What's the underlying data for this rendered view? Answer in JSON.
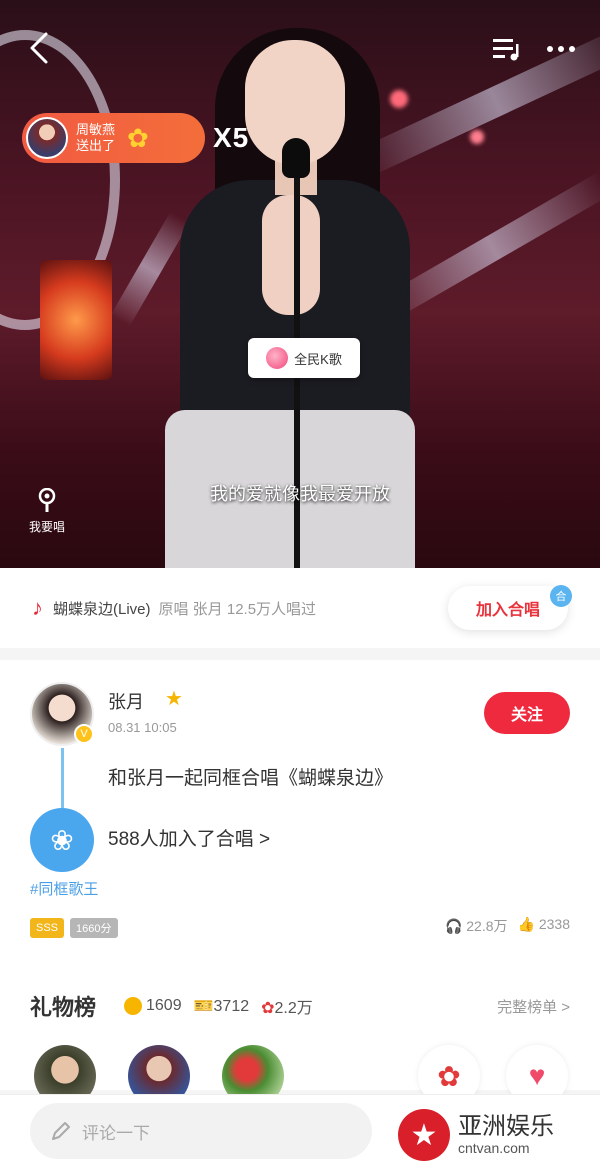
{
  "video": {
    "gift_sender_name": "周敏燕",
    "gift_sender_action": "送出了",
    "gift_count": "X5",
    "logo_text": "全民K歌",
    "solo_label": "我要唱",
    "lyric": "我的爱就像我最爱开放"
  },
  "song": {
    "title": "蝴蝶泉边(Live)",
    "meta": "原唱 张月 12.5万人唱过",
    "join_label": "加入合唱",
    "join_badge": "合"
  },
  "post": {
    "username": "张月",
    "time": "08.31 10:05",
    "follow_label": "关注",
    "text": "和张月一起同框合唱《蝴蝶泉边》",
    "joined": "588人加入了合唱 >",
    "hashtag": "#同框歌王",
    "tag1": "SSS",
    "tag2": "1660分",
    "plays": "22.8万",
    "likes": "2338",
    "verified": "V"
  },
  "gifts": {
    "title": "礼物榜",
    "coins": "1609",
    "tickets": "3712",
    "flowers": "2.2万",
    "full_rank": "完整榜单 >"
  },
  "bottom": {
    "comment_placeholder": "评论一下"
  },
  "watermark": {
    "cn": "亚洲娱乐",
    "en": "cntvan.com"
  },
  "icons": {
    "back": "back-arrow-icon",
    "playlist": "playlist-icon",
    "more": "more-icon",
    "music": "music-note-icon",
    "chorus": "chorus-icon"
  },
  "colors": {
    "accent_red": "#ef2a3e",
    "link_blue": "#4b9fe6",
    "gift_orange": "#f25a42"
  }
}
